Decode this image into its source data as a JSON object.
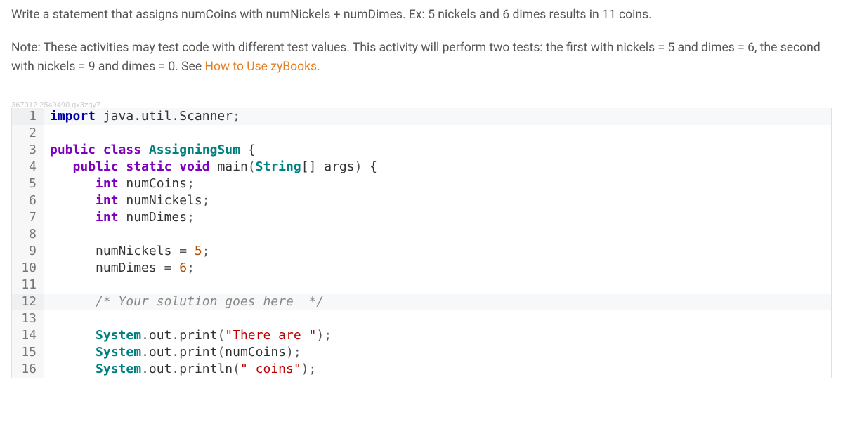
{
  "instructions": {
    "p1": "Write a statement that assigns numCoins with numNickels + numDimes. Ex: 5 nickels and 6 dimes results in 11 coins.",
    "p2_prefix": "Note: These activities may test code with different test values. This activity will perform two tests: the first with nickels = 5 and dimes = 6, the second with nickels = 9 and dimes = 0. See ",
    "p2_link": "How to Use zyBooks",
    "p2_suffix": "."
  },
  "qid": "367012.2549490.qx3zqy7",
  "code": {
    "lines": [
      "1",
      "2",
      "3",
      "4",
      "5",
      "6",
      "7",
      "8",
      "9",
      "10",
      "11",
      "12",
      "13",
      "14",
      "15",
      "16"
    ],
    "l1": {
      "import": "import",
      "pkg": "java.util.Scanner"
    },
    "l3": {
      "mod": "public",
      "cls": "class",
      "name": "AssigningSum"
    },
    "l4": {
      "mod1": "public",
      "mod2": "static",
      "ret": "void",
      "fn": "main",
      "argtype": "String",
      "argname": "args"
    },
    "l5": {
      "type": "int",
      "name": "numCoins"
    },
    "l6": {
      "type": "int",
      "name": "numNickels"
    },
    "l7": {
      "type": "int",
      "name": "numDimes"
    },
    "l9": {
      "name": "numNickels",
      "val": "5"
    },
    "l10": {
      "name": "numDimes",
      "val": "6"
    },
    "l12": {
      "comment": "/* Your solution goes here  */"
    },
    "l14": {
      "cls": "System",
      "fld": "out",
      "fn": "print",
      "str": "\"There are \""
    },
    "l15": {
      "cls": "System",
      "fld": "out",
      "fn": "print",
      "arg": "numCoins"
    },
    "l16": {
      "cls": "System",
      "fld": "out",
      "fn": "println",
      "str": "\" coins\""
    }
  }
}
